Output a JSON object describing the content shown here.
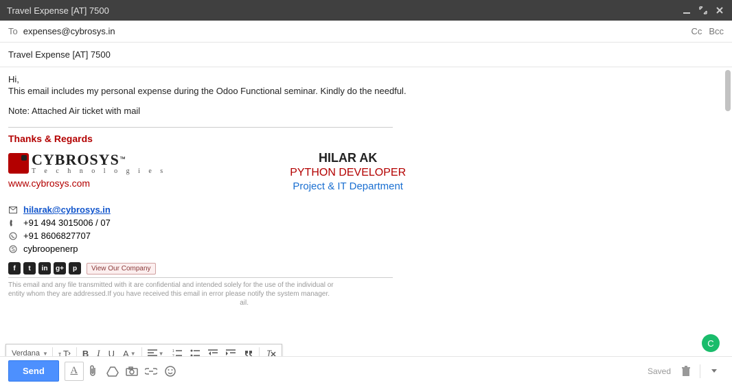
{
  "titlebar": {
    "text": "Travel Expense [AT] 7500"
  },
  "to": {
    "label": "To",
    "value": "expenses@cybrosys.in",
    "cc": "Cc",
    "bcc": "Bcc"
  },
  "subject": {
    "value": "Travel Expense [AT] 7500"
  },
  "body": {
    "greeting": "Hi,",
    "line1": "This email includes my personal expense during the Odoo Functional seminar. Kindly do the needful.",
    "note": "Note: Attached Air ticket with mail"
  },
  "signature": {
    "thanks": "Thanks & Regards",
    "logo_text": "CYBROSYS",
    "logo_tm": "™",
    "logo_sub": "T e c h n o l o g i e s",
    "website": "www.cybrosys.com",
    "name": "HILAR AK",
    "title": "PYTHON DEVELOPER",
    "dept": "Project & IT Department",
    "email": "hilarak@cybrosys.in",
    "phone": "+91 494 3015006 / 07",
    "whatsapp": "+91 8606827707",
    "skype": "cybroopenerp",
    "social": {
      "fb": "f",
      "tw": "t",
      "li": "in",
      "gp": "g+",
      "pin": "p"
    },
    "view_company": "View Our Company",
    "disclaimer1": "This email and any file transmitted with it are confidential and intended solely for the use of the individual or",
    "disclaimer2": "entity whom they are addressed.If you have received this email in error please notify the system manager.",
    "disclaimer3": "ail."
  },
  "format": {
    "font": "Verdana"
  },
  "bottom": {
    "send": "Send",
    "saved": "Saved",
    "green_initial": "C"
  }
}
